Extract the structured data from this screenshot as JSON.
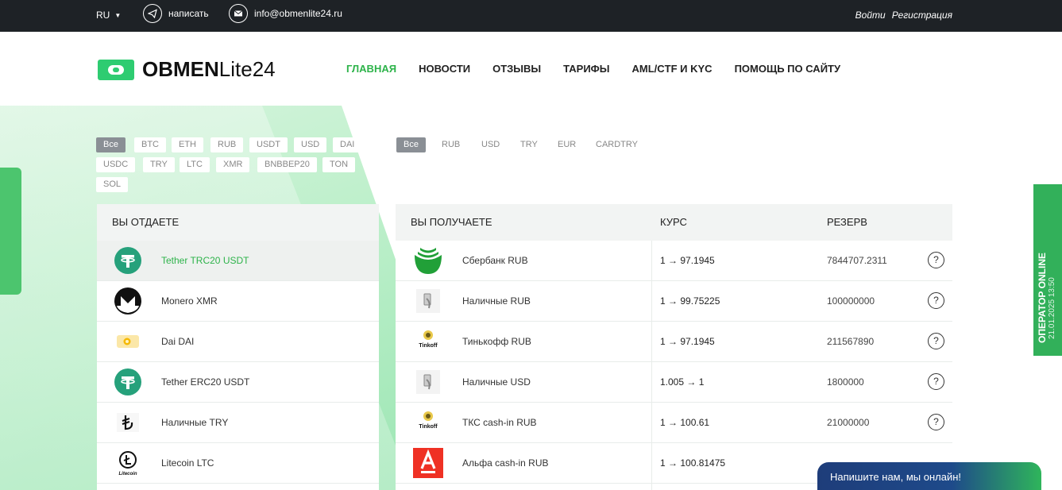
{
  "topbar": {
    "lang": "RU",
    "telegram_label": "написать",
    "email": "info@obmenlite24.ru",
    "login": "Войти",
    "register": "Регистрация"
  },
  "logo": {
    "bold": "OBMEN",
    "light": "Lite24"
  },
  "nav": [
    "ГЛАВНАЯ",
    "НОВОСТИ",
    "ОТЗЫВЫ",
    "ТАРИФЫ",
    "AML/CTF И KYC",
    "ПОМОЩЬ ПО САЙТУ"
  ],
  "give_filters": [
    "Все",
    "BTC",
    "ETH",
    "RUB",
    "USDT",
    "USD",
    "DAI",
    "USDC",
    "TRY",
    "LTC",
    "XMR",
    "BNBBEP20",
    "TON",
    "SOL"
  ],
  "get_filters": [
    "Все",
    "RUB",
    "USD",
    "TRY",
    "EUR",
    "CARDTRY"
  ],
  "give": {
    "header": "ВЫ ОТДАЕТЕ",
    "rows": [
      {
        "label": "Tether TRC20 USDT",
        "icon": "tether-icon"
      },
      {
        "label": "Monero XMR",
        "icon": "monero-icon"
      },
      {
        "label": "Dai DAI",
        "icon": "dai-icon"
      },
      {
        "label": "Tether ERC20 USDT",
        "icon": "tether-icon"
      },
      {
        "label": "Наличные TRY",
        "icon": "lira-icon"
      },
      {
        "label": "Litecoin LTC",
        "icon": "litecoin-icon"
      }
    ]
  },
  "get": {
    "headers": {
      "receive": "ВЫ ПОЛУЧАЕТЕ",
      "rate": "КУРС",
      "reserve": "РЕЗЕРВ"
    },
    "rows": [
      {
        "name": "Сбербанк RUB",
        "rate": "1 → 97.1945",
        "reserve": "7844707.2311",
        "icon": "sberbank-icon"
      },
      {
        "name": "Наличные RUB",
        "rate": "1 → 99.75225",
        "reserve": "100000000",
        "icon": "cash-icon"
      },
      {
        "name": "Тинькофф RUB",
        "rate": "1 → 97.1945",
        "reserve": "211567890",
        "icon": "tinkoff-icon"
      },
      {
        "name": "Наличные USD",
        "rate": "1.005 → 1",
        "reserve": "1800000",
        "icon": "cash-icon"
      },
      {
        "name": "ТКС cash-in RUB",
        "rate": "1 → 100.61",
        "reserve": "21000000",
        "icon": "tinkoff-icon"
      },
      {
        "name": "Альфа cash-in RUB",
        "rate": "1 → 100.81475",
        "reserve": "",
        "icon": "alfa-icon"
      }
    ]
  },
  "tinkoff_label": "Tinkoff",
  "litecoin_label": "Litecoin",
  "operator": {
    "label": "ОПЕРАТОР ONLINE",
    "date": "21.01.2025 13:50"
  },
  "chat": {
    "text": "Напишите нам, мы онлайн!"
  },
  "colors": {
    "accent": "#2db34a",
    "dark": "#1e2226"
  }
}
